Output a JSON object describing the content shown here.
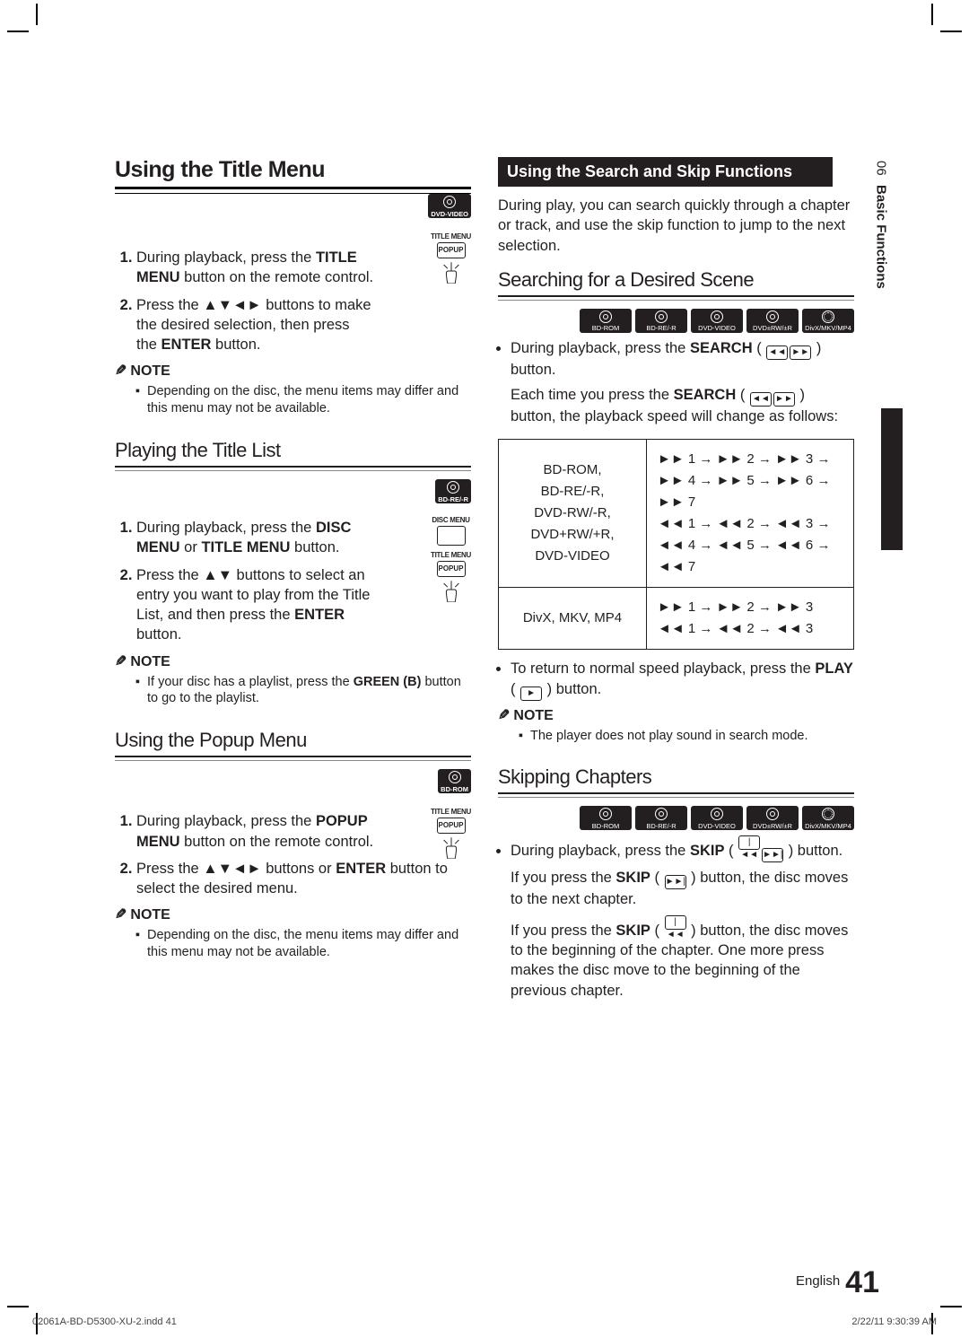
{
  "side": {
    "chapter_num": "06",
    "chapter_title": "Basic Functions"
  },
  "left": {
    "h_title_menu": "Using the Title Menu",
    "badge_dvd_video": "DVD-VIDEO",
    "tm_icon_title_menu": "TITLE MENU",
    "tm_icon_popup": "POPUP",
    "tm_step1_a": "During playback, press the ",
    "tm_step1_b": "TITLE MENU",
    "tm_step1_c": " button on the remote control.",
    "tm_step2_a": "Press the ",
    "tm_step2_b": "▲▼◄►",
    "tm_step2_c": " buttons to make the desired selection, then press the ",
    "tm_step2_d": "ENTER",
    "tm_step2_e": " button.",
    "note_label": "NOTE",
    "tm_note": "Depending on the disc, the menu items may differ and this menu may not be available.",
    "h_title_list": "Playing the Title List",
    "badge_bdre": "BD-RE/-R",
    "tl_icon_disc_menu": "DISC MENU",
    "tl_icon_title_menu": "TITLE MENU",
    "tl_icon_popup": "POPUP",
    "tl_step1_a": "During playback, press the ",
    "tl_step1_b": "DISC MENU",
    "tl_step1_c": " or ",
    "tl_step1_d": "TITLE MENU",
    "tl_step1_e": " button.",
    "tl_step2_a": "Press the ",
    "tl_step2_b": "▲▼",
    "tl_step2_c": " buttons to select an entry you want to play from the Title List, and then press the ",
    "tl_step2_d": "ENTER",
    "tl_step2_e": " button.",
    "tl_note_a": "If your disc has a playlist, press the ",
    "tl_note_b": "GREEN (B)",
    "tl_note_c": " button to go to the playlist.",
    "h_popup": "Using the Popup Menu",
    "badge_bdrom": "BD-ROM",
    "pu_icon_title_menu": "TITLE MENU",
    "pu_icon_popup": "POPUP",
    "pu_step1_a": "During playback, press the ",
    "pu_step1_b": "POPUP MENU",
    "pu_step1_c": " button on the remote control.",
    "pu_step2_a": "Press the ",
    "pu_step2_b": "▲▼◄►",
    "pu_step2_c": " buttons or ",
    "pu_step2_d": "ENTER",
    "pu_step2_e": " button to select the desired menu.",
    "pu_note": "Depending on the disc, the menu items may differ and this menu may not be available."
  },
  "right": {
    "section_bar": "Using the Search and Skip Functions",
    "intro": "During play, you can search quickly through a chapter or track, and use the skip function to jump to the next selection.",
    "h_search": "Searching for a Desired Scene",
    "badges": [
      "BD-ROM",
      "BD-RE/-R",
      "DVD-VIDEO",
      "DVD±RW/±R",
      "DivX/MKV/MP4"
    ],
    "search_bullet_a": "During playback, press the ",
    "search_bullet_b": "SEARCH",
    "search_bullet_c": " ( ",
    "search_bullet_d": " ) button.",
    "search_line2_a": "Each time you press the ",
    "search_line2_b": "SEARCH",
    "search_line2_c": " ( ",
    "search_line2_d": " ) button, the playback speed will change as follows:",
    "table_left1": "BD-ROM,\nBD-RE/-R,\nDVD-RW/-R,\nDVD+RW/+R,\nDVD-VIDEO",
    "table_right1": " 1 →  2 →  3 →\n 4 →  5 →  6 →  7\n 1 →  2 →  3 →\n 4 →  5 →  6 →  7",
    "table_left2": "DivX, MKV, MP4",
    "table_right2": " 1 →  2 →  3\n 1 →  2 →  3",
    "return_a": "To return to normal speed playback, press the ",
    "return_b": "PLAY",
    "return_c": " ( ",
    "return_d": " ) button.",
    "search_note": "The player does not play sound in search mode.",
    "h_skip": "Skipping Chapters",
    "skip_badges": [
      "BD-ROM",
      "BD-RE/-R",
      "DVD-VIDEO",
      "DVD±RW/±R",
      "DivX/MKV/MP4"
    ],
    "skip_bullet_a": "During playback, press the ",
    "skip_bullet_b": "SKIP",
    "skip_bullet_c": " ( ",
    "skip_bullet_d": " ) button.",
    "skip_p1_a": "If you press the ",
    "skip_p1_b": "SKIP",
    "skip_p1_c": " ( ",
    "skip_p1_d": " ) button, the disc moves to the next chapter.",
    "skip_p2_a": "If you press the ",
    "skip_p2_b": "SKIP",
    "skip_p2_c": " ( ",
    "skip_p2_d": " ) button, the disc moves to the beginning of the chapter. One more press makes the disc move to the beginning of the previous chapter."
  },
  "footer": {
    "lang": "English",
    "page": "41"
  },
  "print": {
    "file": "02061A-BD-D5300-XU-2.indd   41",
    "stamp": "2/22/11   9:30:39 AM"
  }
}
